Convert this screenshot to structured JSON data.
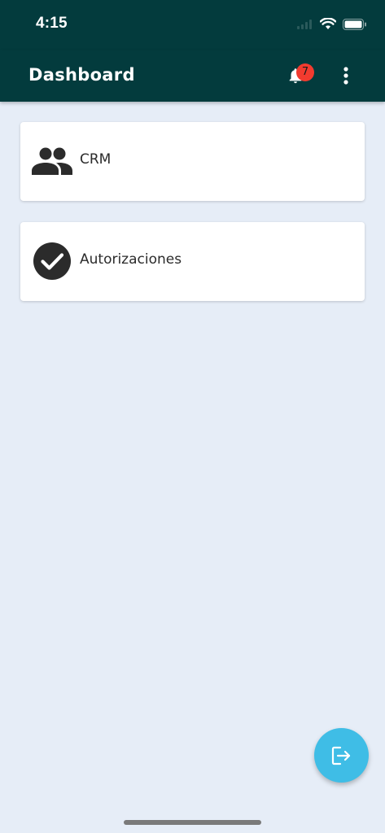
{
  "status_bar": {
    "time": "4:15"
  },
  "app_bar": {
    "title": "Dashboard",
    "notification_count": "7"
  },
  "cards": [
    {
      "label": "CRM",
      "icon": "people-icon"
    },
    {
      "label": "Autorizaciones",
      "icon": "check-circle-icon"
    }
  ],
  "fab": {
    "icon": "logout-icon"
  },
  "colors": {
    "app_bar": "#033b3d",
    "background": "#e6edf7",
    "badge": "#f23b2f",
    "fab": "#3fbde6",
    "card_text": "#2b2b2b"
  }
}
